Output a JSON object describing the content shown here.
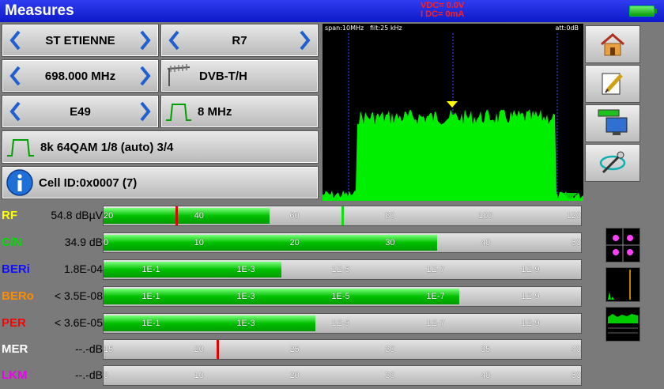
{
  "title": "Measures",
  "power": {
    "vdc": "VDC= 0.0V",
    "idc": "I DC=  0mA"
  },
  "row1": {
    "left_label": "ST ETIENNE",
    "right_label": "R7"
  },
  "row2": {
    "left_label": "698.000 MHz",
    "right_label": "DVB-T/H"
  },
  "row3": {
    "left_label": "E49",
    "right_label": "8 MHz"
  },
  "modulation": "8k 64QAM 1/8 (auto) 3/4",
  "cell": "Cell ID:0x0007 (7)",
  "spectrum": {
    "span": "span:10MHz",
    "filt": "filt:25 kHz",
    "att": "att:0dB"
  },
  "measures": [
    {
      "name": "RF",
      "color": "#ffff00",
      "value": "54.8 dBµV",
      "fill": 0.348,
      "ticks": [
        "20",
        "40",
        "60",
        "80",
        "100",
        "120"
      ],
      "marker_red": 0.15,
      "marker_green": 0.498
    },
    {
      "name": "C/N",
      "color": "#00dd00",
      "value": "34.9 dB",
      "fill": 0.698,
      "ticks": [
        "0",
        "10",
        "20",
        "30",
        "40",
        "50"
      ]
    },
    {
      "name": "BERi",
      "color": "#1010ff",
      "value": "1.8E-04",
      "fill": 0.373,
      "ticks": [
        "1E-1",
        "1E-3",
        "1E-5",
        "1E-7",
        "1E-9"
      ]
    },
    {
      "name": "BERo",
      "color": "#ff8c00",
      "value": "< 3.5E-08",
      "fill": 0.745,
      "ticks": [
        "1E-1",
        "1E-3",
        "1E-5",
        "1E-7",
        "1E-9"
      ]
    },
    {
      "name": "PER",
      "color": "#ff0000",
      "value": "< 3.6E-05",
      "fill": 0.443,
      "ticks": [
        "1E-1",
        "1E-3",
        "1E-5",
        "1E-7",
        "1E-9"
      ]
    },
    {
      "name": "MER",
      "color": "#ffffff",
      "value": "--.-dB",
      "fill": 0,
      "ticks": [
        "15",
        "20",
        "25",
        "30",
        "35",
        "40"
      ],
      "marker_red": 0.237
    },
    {
      "name": "LKM",
      "color": "#ee00ee",
      "value": "--.-dB",
      "fill": 0,
      "ticks": [
        "0",
        "10",
        "20",
        "30",
        "40",
        "50"
      ]
    }
  ]
}
